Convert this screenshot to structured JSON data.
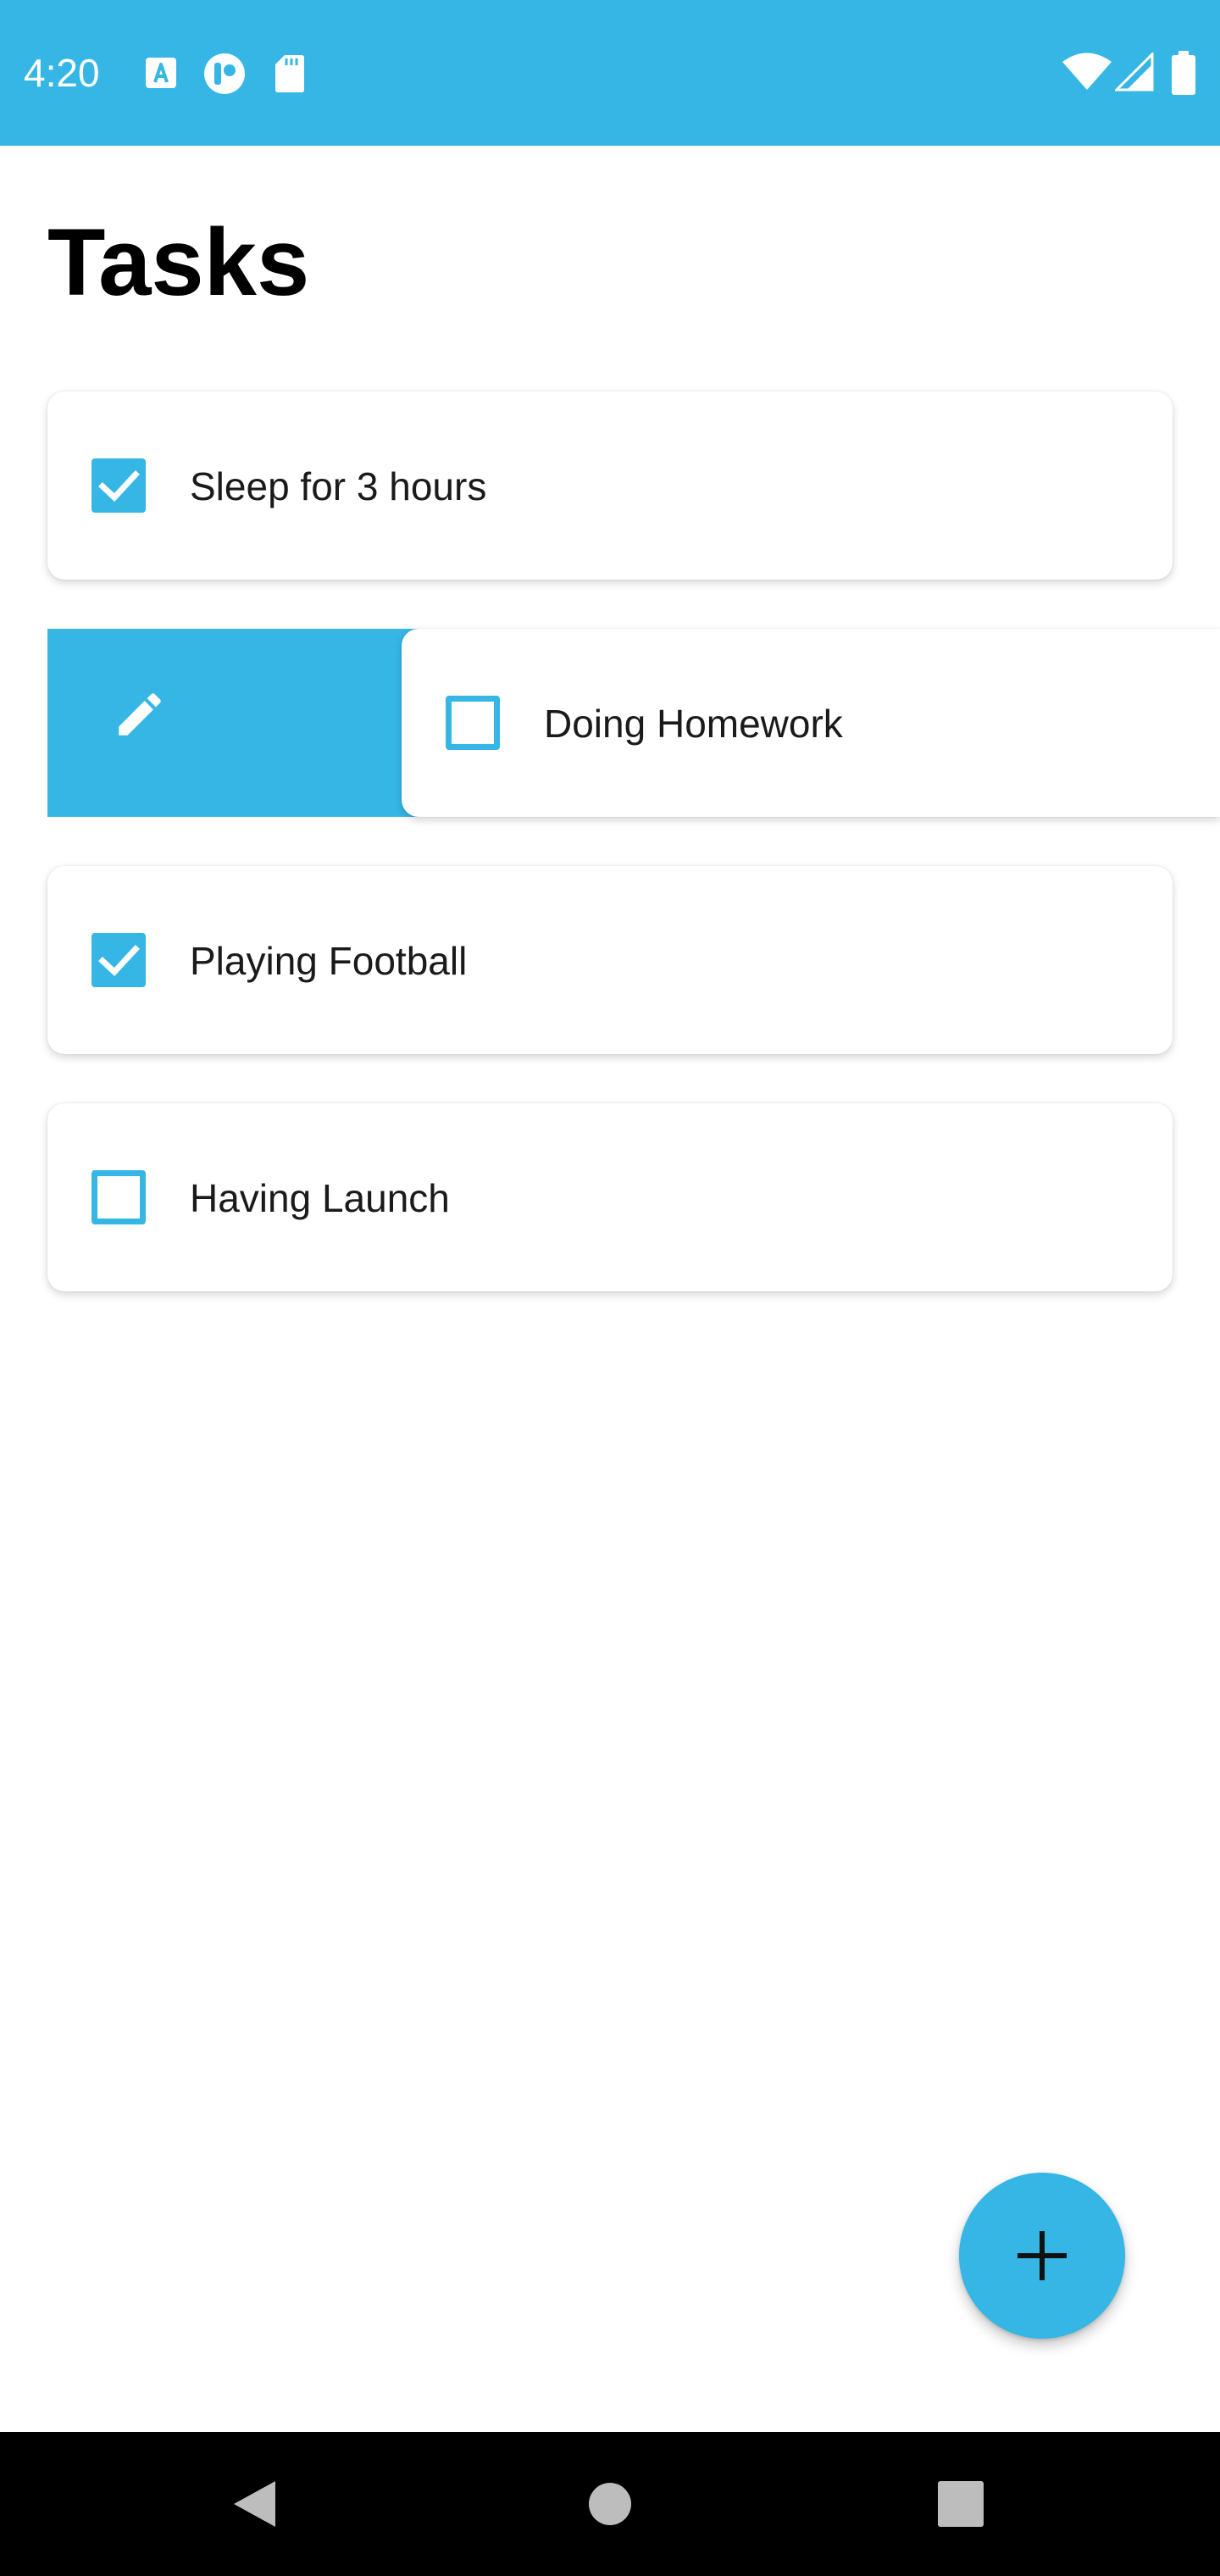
{
  "status_bar": {
    "time": "4:20",
    "background": "#35b6e5",
    "left_icons": [
      "a-badge-icon",
      "face-app-icon",
      "sd-card-icon"
    ],
    "right_icons": [
      "wifi-icon",
      "cell-signal-icon",
      "battery-icon"
    ]
  },
  "page": {
    "title": "Tasks"
  },
  "tasks": [
    {
      "label": "Sleep for 3 hours",
      "checked": true
    },
    {
      "label": "Doing Homework",
      "checked": false,
      "swiped_open": true,
      "swipe_action_icon": "edit-icon"
    },
    {
      "label": "Playing Football",
      "checked": true
    },
    {
      "label": "Having Launch",
      "checked": false
    }
  ],
  "fab": {
    "icon": "plus-icon"
  },
  "nav_bar": {
    "buttons": [
      "back-icon",
      "home-icon",
      "recents-icon"
    ]
  },
  "colors": {
    "accent": "#35b6e5",
    "text": "#1a1a1a",
    "nav_background": "#000000"
  }
}
